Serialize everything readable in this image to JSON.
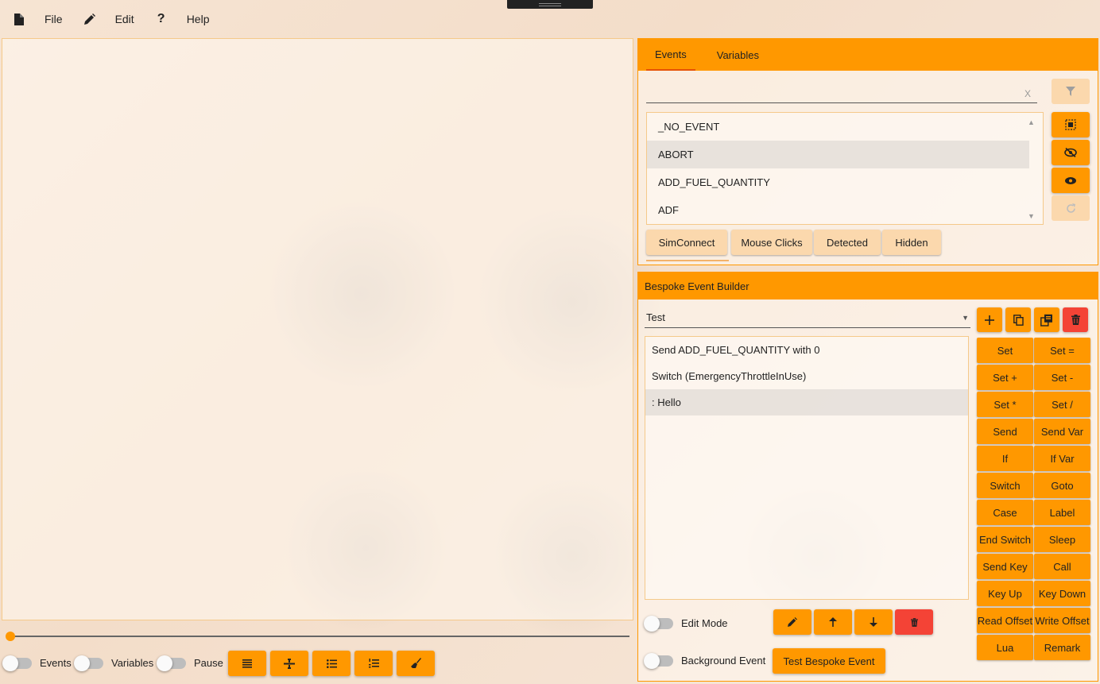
{
  "menu": {
    "items": [
      {
        "label": "File",
        "icon": "file-icon"
      },
      {
        "label": "Edit",
        "icon": "pencil-icon"
      },
      {
        "label": "Help",
        "icon": "question-icon"
      }
    ]
  },
  "bottom_bar": {
    "slider_value": 0,
    "toggles": {
      "events": "Events",
      "variables": "Variables",
      "pause": "Pause"
    },
    "action_icons": [
      "align-justify-icon",
      "divide-icon",
      "list-icon",
      "ordered-list-icon",
      "broom-icon"
    ]
  },
  "events_panel": {
    "tabs": [
      "Events",
      "Variables"
    ],
    "active_tab": "Events",
    "search": {
      "value": "",
      "clear_label": "X"
    },
    "items": [
      "_NO_EVENT",
      "ABORT",
      "ADD_FUEL_QUANTITY",
      "ADF"
    ],
    "selected_item": "ABORT",
    "side_buttons": [
      "filter-icon",
      "select-all-icon",
      "eye-slash-icon",
      "eye-icon",
      "refresh-icon"
    ],
    "filters": [
      "SimConnect",
      "Mouse Clicks",
      "Detected",
      "Hidden"
    ],
    "active_filter": "SimConnect"
  },
  "builder": {
    "title": "Bespoke Event Builder",
    "selected_script": "Test",
    "header_buttons": [
      "plus-icon",
      "copy-icon",
      "duplicate-icon",
      "trash-icon"
    ],
    "lines": [
      "Send ADD_FUEL_QUANTITY with 0",
      "Switch (EmergencyThrottleInUse)",
      ": Hello"
    ],
    "selected_line": ": Hello",
    "commands": [
      [
        "Set",
        "Set ="
      ],
      [
        "Set +",
        "Set -"
      ],
      [
        "Set *",
        "Set /"
      ],
      [
        "Send",
        "Send Var"
      ],
      [
        "If",
        "If Var"
      ],
      [
        "Switch",
        "Goto"
      ],
      [
        "Case",
        "Label"
      ],
      [
        "End Switch",
        "Sleep"
      ],
      [
        "Send Key",
        "Call"
      ],
      [
        "Key Up",
        "Key Down"
      ],
      [
        "Read Offset",
        "Write Offset"
      ],
      [
        "Lua",
        "Remark"
      ]
    ],
    "edit_mode_label": "Edit Mode",
    "background_event_label": "Background Event",
    "line_buttons": [
      "pencil-icon",
      "arrow-up-icon",
      "arrow-down-icon",
      "trash-icon"
    ],
    "test_button": "Test Bespoke Event"
  },
  "colors": {
    "accent": "#ff9800",
    "danger": "#f44336",
    "chip": "#fbd8ad"
  }
}
